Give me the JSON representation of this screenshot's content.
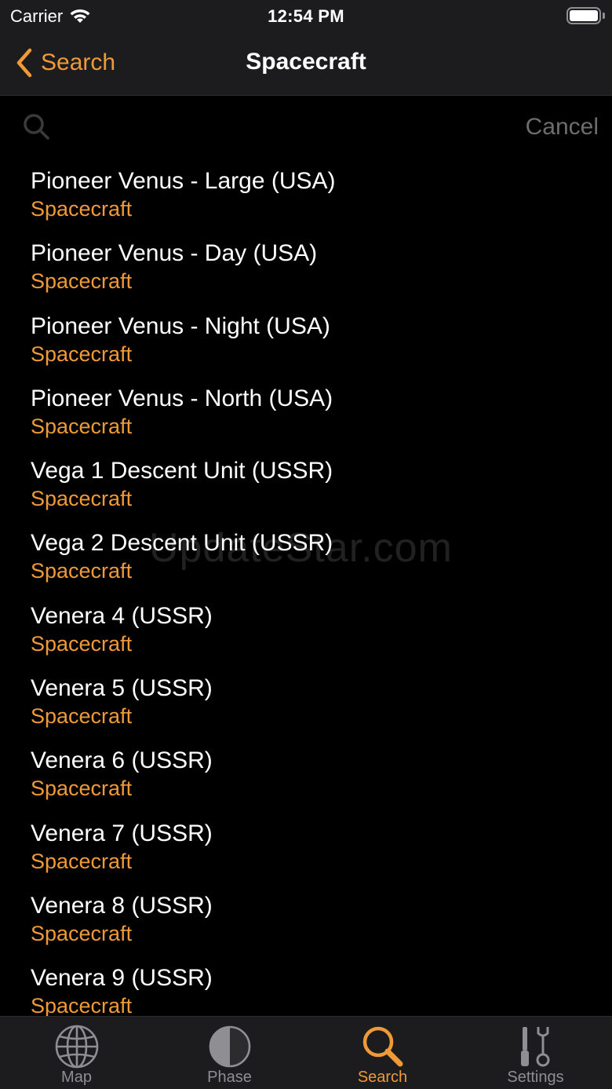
{
  "status_bar": {
    "carrier": "Carrier",
    "time": "12:54 PM"
  },
  "nav": {
    "back_label": "Search",
    "title": "Spacecraft"
  },
  "search": {
    "placeholder": "",
    "cancel_label": "Cancel"
  },
  "results": [
    {
      "title": "Pioneer Venus - Large (USA)",
      "subtitle": "Spacecraft"
    },
    {
      "title": "Pioneer Venus - Day (USA)",
      "subtitle": "Spacecraft"
    },
    {
      "title": "Pioneer Venus - Night (USA)",
      "subtitle": "Spacecraft"
    },
    {
      "title": "Pioneer Venus - North (USA)",
      "subtitle": "Spacecraft"
    },
    {
      "title": "Vega 1 Descent Unit (USSR)",
      "subtitle": "Spacecraft"
    },
    {
      "title": "Vega 2 Descent Unit (USSR)",
      "subtitle": "Spacecraft"
    },
    {
      "title": "Venera 4 (USSR)",
      "subtitle": "Spacecraft"
    },
    {
      "title": "Venera 5 (USSR)",
      "subtitle": "Spacecraft"
    },
    {
      "title": "Venera 6 (USSR)",
      "subtitle": "Spacecraft"
    },
    {
      "title": "Venera 7 (USSR)",
      "subtitle": "Spacecraft"
    },
    {
      "title": "Venera 8 (USSR)",
      "subtitle": "Spacecraft"
    },
    {
      "title": "Venera 9 (USSR)",
      "subtitle": "Spacecraft"
    }
  ],
  "watermark": "UpdateStar.com",
  "tabs": [
    {
      "label": "Map",
      "icon": "globe-icon",
      "active": false
    },
    {
      "label": "Phase",
      "icon": "moon-phase-icon",
      "active": false
    },
    {
      "label": "Search",
      "icon": "search-icon",
      "active": true
    },
    {
      "label": "Settings",
      "icon": "tools-icon",
      "active": false
    }
  ],
  "colors": {
    "accent": "#f09a37",
    "background": "#000000",
    "bar": "#1c1c1e",
    "inactive": "#8e8e93"
  }
}
